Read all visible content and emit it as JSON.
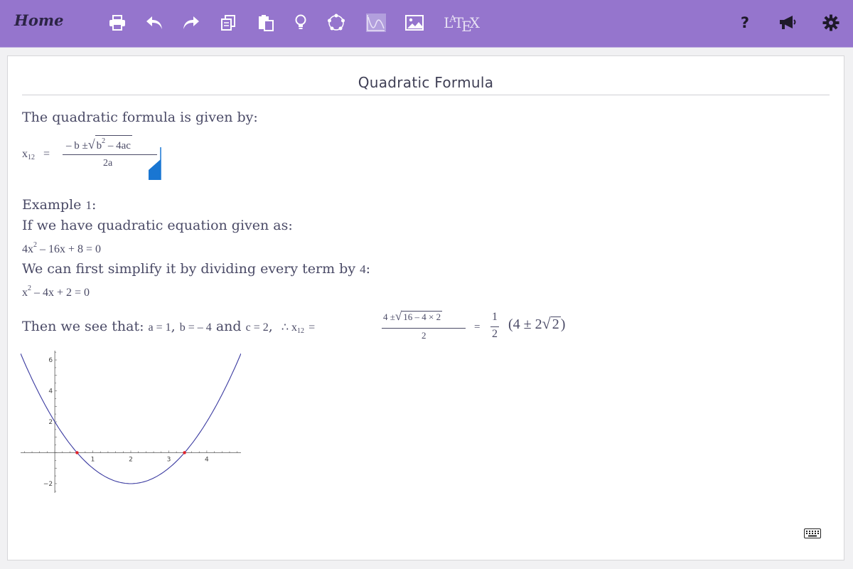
{
  "toolbar": {
    "home_label": "Home",
    "icons": [
      "print-icon",
      "undo-icon",
      "redo-icon",
      "copy-icon",
      "paste-icon",
      "lightbulb-icon",
      "circle-dots-icon",
      "graph-icon",
      "image-icon",
      "latex-icon",
      "help-icon",
      "megaphone-icon",
      "gear-icon"
    ],
    "latex_parts": [
      "L",
      "A",
      "T",
      "E",
      "X"
    ],
    "help_label": "?"
  },
  "colors": {
    "topbar": "#9575cd",
    "text": "#4a4a66",
    "curve": "#3a3aa0",
    "root_point": "#e0212a",
    "cursor": "#1976d2"
  },
  "document": {
    "title": "Quadratic Formula",
    "intro": "The quadratic formula is given by:",
    "formula": {
      "lhs": "x",
      "lhs_sub": "12",
      "eq": "=",
      "num_prefix": "– b ±",
      "radicand_b": "b",
      "radicand_sup": "2",
      "radicand_rest": "– 4ac",
      "den": "2a"
    },
    "example_label": "Example ",
    "example_num": "1",
    "example_colon": ":",
    "if_text": "If we have quadratic equation given as:",
    "eq1": {
      "a": "4x",
      "sup": "2",
      "rest": "– 16x + 8 = 0"
    },
    "simplify_text": "We can first simplify it by dividing every term by ",
    "simplify_num": "4",
    "simplify_colon": ":",
    "eq2": {
      "a": "x",
      "sup": "2",
      "rest": "– 4x + 2 = 0"
    },
    "then_text": "Then we see that: ",
    "then_a": "a = 1",
    "then_b": "b =  – 4",
    "then_and": " and ",
    "then_c": "c = 2",
    "then_therefore": "∴ x",
    "then_sub": "12",
    "then_eq": "=",
    "sol_num_prefix": "4 ±",
    "sol_radicand": "16 – 4 × 2",
    "sol_den": "2",
    "sol_eq2": "=",
    "half_num": "1",
    "half_den": "2",
    "sol_paren": "(4 ± 2",
    "sol_sqrt_arg": "2",
    "sol_close": ")"
  },
  "chart_data": {
    "type": "line",
    "function": "x^2 - 4x + 2",
    "series": [
      {
        "values": [
          [
            -0.8,
            7.04
          ],
          [
            -0.5,
            4.25
          ],
          [
            0,
            2
          ],
          [
            0.5,
            0.25
          ],
          [
            1,
            -1
          ],
          [
            1.5,
            -1.75
          ],
          [
            2,
            -2
          ],
          [
            2.5,
            -1.75
          ],
          [
            3,
            -1
          ],
          [
            3.5,
            0.25
          ],
          [
            4,
            2
          ],
          [
            4.5,
            4.25
          ],
          [
            4.8,
            7.04
          ]
        ]
      }
    ],
    "roots": [
      0.586,
      3.414
    ],
    "xlim": [
      -0.9,
      4.9
    ],
    "ylim": [
      -2.6,
      6.6
    ],
    "x_ticks": [
      1,
      2,
      3,
      4
    ],
    "y_ticks": [
      -2,
      2,
      4,
      6
    ],
    "x_tick_labels": [
      "1",
      "2",
      "3",
      "4"
    ],
    "y_tick_labels": [
      "−2",
      "2",
      "4",
      "6"
    ],
    "grid": false
  }
}
